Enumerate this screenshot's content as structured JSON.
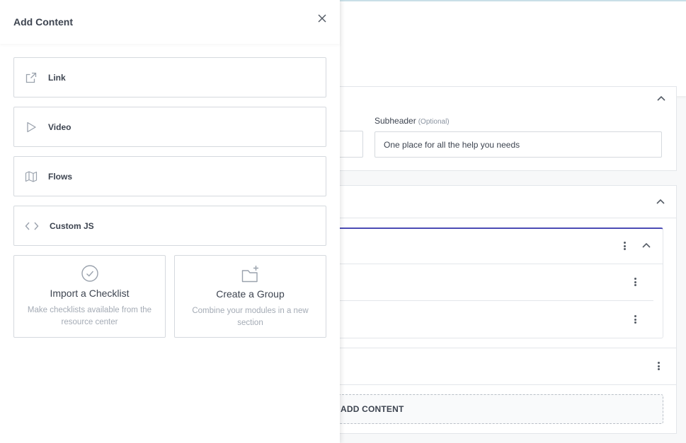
{
  "drawer": {
    "title": "Add Content",
    "options": [
      {
        "label": "Link",
        "icon": "external-link-icon"
      },
      {
        "label": "Video",
        "icon": "play-icon"
      },
      {
        "label": "Flows",
        "icon": "map-icon"
      },
      {
        "label": "Custom JS",
        "icon": "code-icon"
      }
    ],
    "tiles": [
      {
        "title": "Import a Checklist",
        "description": "Make checklists available from the resource center",
        "icon": "check-circle-icon"
      },
      {
        "title": "Create a Group",
        "description": "Combine your modules in a new section",
        "icon": "folder-plus-icon"
      }
    ]
  },
  "background": {
    "subheader_label": "Subheader",
    "subheader_optional": "(Optional)",
    "subheader_value": "One place for all the help you needs",
    "add_content_label": "ADD CONTENT"
  },
  "colors": {
    "accent": "#4b4bb5",
    "border": "#d5d9de",
    "text": "#3d4450",
    "muted": "#a4abb5"
  }
}
